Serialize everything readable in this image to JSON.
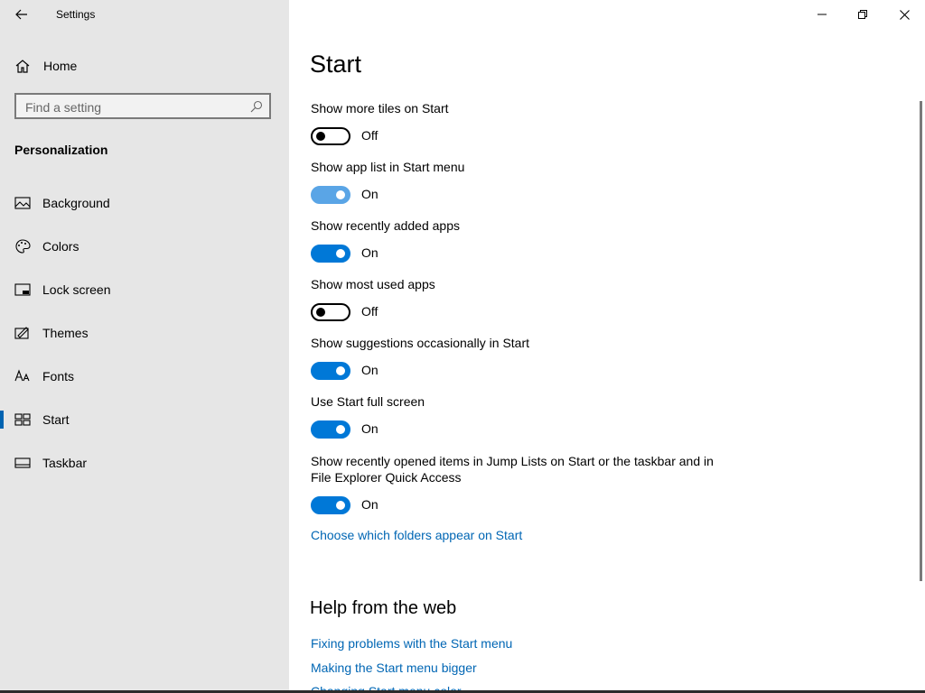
{
  "window": {
    "title": "Settings"
  },
  "sidebar": {
    "home_label": "Home",
    "search_placeholder": "Find a setting",
    "section_title": "Personalization",
    "items": [
      {
        "label": "Background",
        "icon": "background-icon"
      },
      {
        "label": "Colors",
        "icon": "palette-icon"
      },
      {
        "label": "Lock screen",
        "icon": "lock-screen-icon"
      },
      {
        "label": "Themes",
        "icon": "themes-icon"
      },
      {
        "label": "Fonts",
        "icon": "fonts-icon"
      },
      {
        "label": "Start",
        "icon": "start-icon",
        "selected": true
      },
      {
        "label": "Taskbar",
        "icon": "taskbar-icon"
      }
    ]
  },
  "main": {
    "title": "Start",
    "settings": [
      {
        "label": "Show more tiles on Start",
        "state": "Off"
      },
      {
        "label": "Show app list in Start menu",
        "state": "On"
      },
      {
        "label": "Show recently added apps",
        "state": "On"
      },
      {
        "label": "Show most used apps",
        "state": "Off"
      },
      {
        "label": "Show suggestions occasionally in Start",
        "state": "On"
      },
      {
        "label": "Use Start full screen",
        "state": "On"
      },
      {
        "label": "Show recently opened items in Jump Lists on Start or the taskbar and in File Explorer Quick Access",
        "state": "On"
      }
    ],
    "folders_link": "Choose which folders appear on Start",
    "help": {
      "title": "Help from the web",
      "links": [
        "Fixing problems with the Start menu",
        "Making the Start menu bigger",
        "Changing Start menu color"
      ]
    }
  },
  "colors": {
    "accent": "#0078d7",
    "accent_hover": "#5aa5e6",
    "link": "#0066b4",
    "sidebar_bg": "#e6e6e6"
  }
}
